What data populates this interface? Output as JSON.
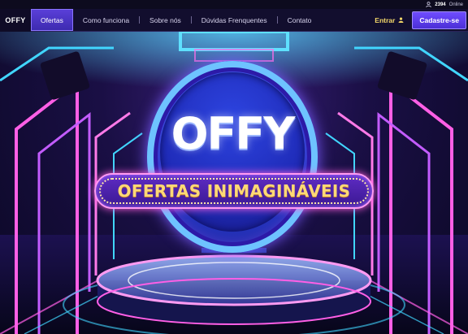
{
  "status": {
    "online_count": "2394",
    "online_label": "Online"
  },
  "nav": {
    "logo": "OFFY",
    "items": [
      {
        "label": "Ofertas",
        "active": true
      },
      {
        "label": "Como funciona",
        "active": false
      },
      {
        "label": "Sobre nós",
        "active": false
      },
      {
        "label": "Dúvidas Frenquentes",
        "active": false
      },
      {
        "label": "Contato",
        "active": false
      }
    ],
    "login_label": "Entrar",
    "signup_label": "Cadastre-se"
  },
  "hero": {
    "brand": "OFFY",
    "slogan": "OFERTAS INIMAGINÁVEIS"
  },
  "colors": {
    "accent": "#5a3fd8",
    "login": "#f5d96a",
    "slogan_text": "#ffd975",
    "neon_pink": "#ff4fe0",
    "neon_cyan": "#41d6ff"
  },
  "icons": {
    "user": "user-icon"
  }
}
